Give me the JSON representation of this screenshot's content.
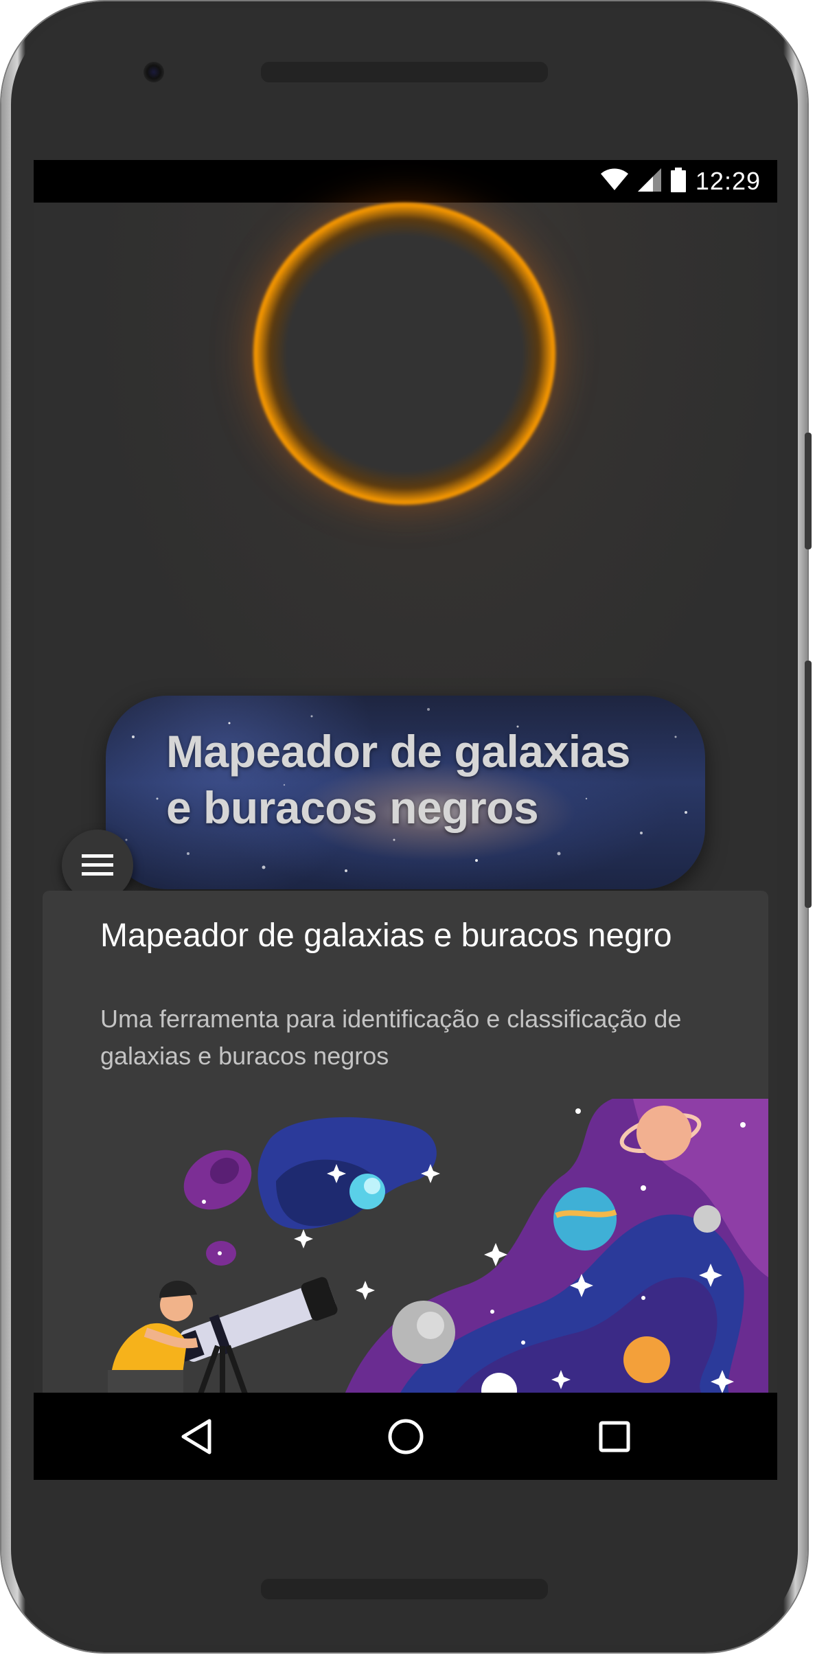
{
  "status_bar": {
    "time": "12:29",
    "icons": [
      "wifi-icon",
      "signal-icon",
      "battery-icon"
    ]
  },
  "hero": {
    "title": "Mapeador de galaxias e buracos negros"
  },
  "menu": {
    "icon": "hamburger-menu-icon"
  },
  "card": {
    "title": "Mapeador de galaxias e buracos negro",
    "subtitle": "Uma ferramenta para identificação e classificação de galaxias e buracos negros"
  },
  "navigation_bar": {
    "back_icon": "back-triangle-icon",
    "home_icon": "home-circle-icon",
    "recents_icon": "recents-square-icon"
  },
  "colors": {
    "ring_orange": "#ff8a00",
    "background": "#2f2f2f",
    "card": "#3b3b3b",
    "space_purple": "#6a2c91",
    "space_blue": "#2b3a9a"
  }
}
